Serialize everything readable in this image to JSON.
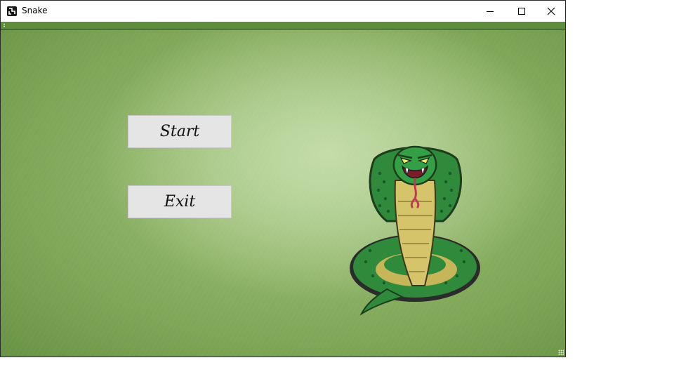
{
  "window": {
    "title": "Snake",
    "icon": "app-icon",
    "controls": [
      "minimize-icon",
      "maximize-icon",
      "close-icon"
    ]
  },
  "menu": {
    "start_label": "Start",
    "exit_label": "Exit"
  },
  "art": {
    "mascot": "cobra-illustration"
  },
  "colors": {
    "background_light": "#c4dca9",
    "background_dark": "#5f8a3c",
    "button_face": "#e5e5e5",
    "snake_green": "#2f8a3c",
    "snake_belly": "#d6c46a"
  }
}
